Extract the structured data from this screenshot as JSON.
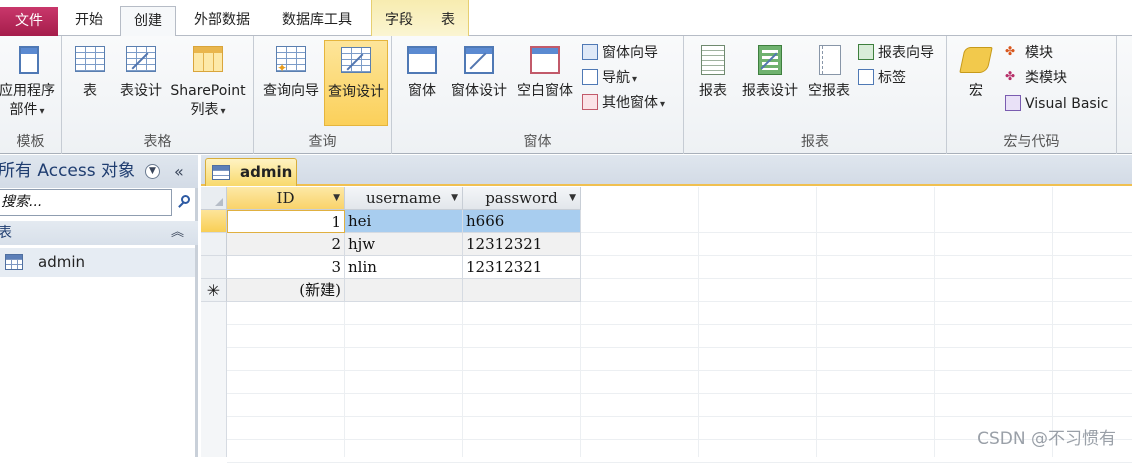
{
  "tabs": [
    "文件",
    "开始",
    "创建",
    "外部数据",
    "数据库工具",
    "字段",
    "表"
  ],
  "ribbon": {
    "templates": {
      "title": "模板",
      "app_parts_line1": "应用程序",
      "app_parts_line2": "部件"
    },
    "tables": {
      "title": "表格",
      "table": "表",
      "table_design": "表设计",
      "sharepoint_line1": "SharePoint",
      "sharepoint_line2": "列表"
    },
    "queries": {
      "title": "查询",
      "wizard": "查询向导",
      "design": "查询设计"
    },
    "forms": {
      "title": "窗体",
      "form": "窗体",
      "design": "窗体设计",
      "blank": "空白窗体",
      "wizard": "窗体向导",
      "navigation": "导航",
      "more": "其他窗体"
    },
    "reports": {
      "title": "报表",
      "report": "报表",
      "design": "报表设计",
      "blank": "空报表",
      "wizard": "报表向导",
      "labels": "标签"
    },
    "macros": {
      "title": "宏与代码",
      "macro": "宏",
      "module": "模块",
      "class_module": "类模块",
      "vba": "Visual Basic"
    }
  },
  "nav": {
    "title": "所有 Access 对象",
    "search_placeholder": "搜索...",
    "group": "表",
    "items": [
      "admin"
    ]
  },
  "document": {
    "tab": "admin",
    "columns": [
      "ID",
      "username",
      "password"
    ],
    "rows": [
      {
        "id": "1",
        "username": "hei",
        "password": "h666"
      },
      {
        "id": "2",
        "username": "hjw",
        "password": "12312321"
      },
      {
        "id": "3",
        "username": "nlin",
        "password": "12312321"
      }
    ],
    "new_record": "(新建)"
  },
  "watermark": "CSDN @不习惯有",
  "colors": {
    "file_tab": "#b52a5a",
    "selection": "#a8cdef",
    "highlight": "#fbd05a"
  }
}
